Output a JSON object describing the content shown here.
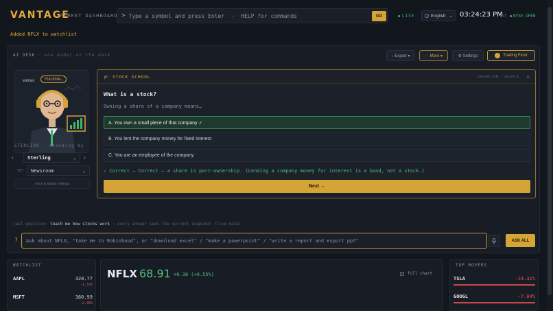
{
  "header": {
    "brand": "VANTAGE",
    "brand_sub": "MARKET DASHBOARD",
    "command_prompt": ">",
    "command_placeholder": "Type a symbol and press Enter  ·  HELP for commands",
    "go_label": "GO",
    "live_label": "LIVE",
    "language": "English",
    "clock": "03:24:23 PM",
    "timezone": "EST",
    "market_status": "NYSE OPEN"
  },
  "toast": "Added NFLX to watchlist",
  "desk": {
    "title": "AI DESK",
    "subtitle": "· one model on the desk",
    "export_label": "↓ Export ▾",
    "more_label": "··· More ▾",
    "settings_label": "⚙ Settings",
    "floor_label": "Trading Floor",
    "avatar": {
      "badge": "TEACHING…",
      "logo": "VANTAGE",
      "name_line": "STERLING · standing by",
      "selected": "Sterling",
      "prev_label": "‹",
      "next_label": "›",
      "set_label": "SET",
      "set_value": "Newsroom",
      "voice_label": "voice & avatar settings"
    },
    "school": {
      "title": "STOCK SCHOOL",
      "meta": "lesson 1/8 · score 1",
      "close_label": "✕",
      "question": "What is a stock?",
      "prompt": "Owning a share of a company means…",
      "options": [
        "A. You own a small piece of that company ✓",
        "B. You lent the company money for fixed interest",
        "C. You are an employee of the company"
      ],
      "feedback": "✓ Correct — Correct — a share is part-ownership. (Lending a company money for interest is a bond, not a stock.)",
      "next_label": "Next →"
    },
    "last_question_label": "last question:",
    "last_question": "teach me how stocks work",
    "last_question_note": "· every answer sees the current snapshot (live data)",
    "ask_marker": "?",
    "ask_placeholder": "Ask about NFLX, \"take me to Robinhood\", or \"download excel\" / \"make a powerpoint\" / \"write a report and export ppt\"",
    "ask_all_label": "ASK ALL"
  },
  "watchlist": {
    "title": "WATCHLIST",
    "rows": [
      {
        "symbol": "AAPL",
        "price": "320.77",
        "change": "-1.57%"
      },
      {
        "symbol": "MSFT",
        "price": "380.99",
        "change": "-2.48%"
      }
    ]
  },
  "quote": {
    "symbol": "NFLX",
    "price": "68.91",
    "change": "+0.38 (+0.55%)",
    "full_chart_label": "full chart"
  },
  "movers": {
    "title": "TOP MOVERS",
    "rows": [
      {
        "symbol": "TSLA",
        "change": "-14.31%"
      },
      {
        "symbol": "GOOGL",
        "change": "-7.04%"
      }
    ]
  },
  "colors": {
    "accent": "#d4a437",
    "positive": "#4fc27a",
    "negative": "#e25555",
    "background": "#12161d"
  }
}
